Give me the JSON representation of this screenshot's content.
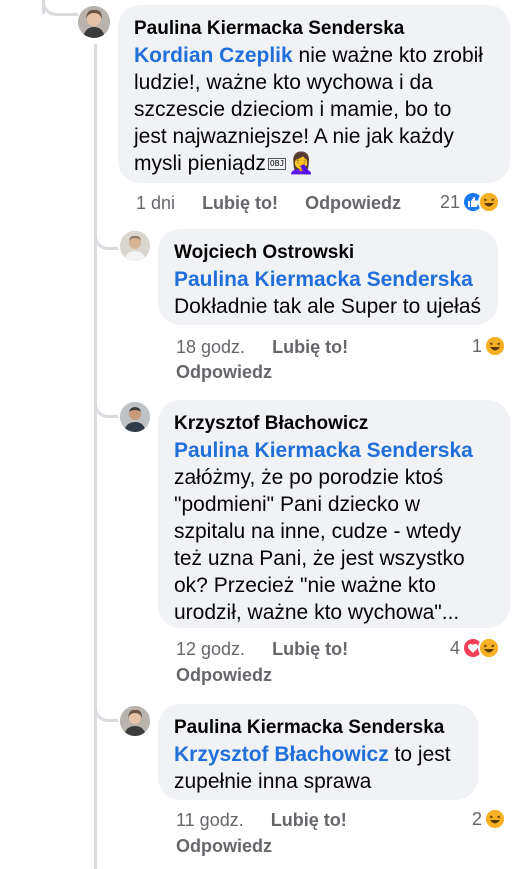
{
  "comments": [
    {
      "author": "Paulina Kiermacka Senderska",
      "mention": "Kordian Czeplik",
      "text_lines": [
        " nie ważne kto zrobił",
        "ludzie!, ważne kto wychowa i da",
        "szczescie dzieciom i mamie, bo to",
        "jest najwazniejsze! A nie jak każdy",
        "mysli pieniądz"
      ],
      "obj_glyph": "OBJ",
      "emoji": "🤦‍♀️",
      "time": "1 dni",
      "like_label": "Lubię to!",
      "reply_label": "Odpowiedz",
      "reaction_count": "21",
      "reactions": [
        "like",
        "haha"
      ]
    },
    {
      "author": "Wojciech Ostrowski",
      "mention": "Paulina Kiermacka Senderska",
      "text": "Dokładnie tak ale Super to ujełaś",
      "time": "18 godz.",
      "like_label": "Lubię to!",
      "reply_label": "Odpowiedz",
      "reaction_count": "1",
      "reactions": [
        "haha"
      ]
    },
    {
      "author": "Krzysztof Błachowicz",
      "mention": "Paulina Kiermacka Senderska",
      "text_lines": [
        "załóżmy, że po porodzie ktoś",
        "\"podmieni\" Pani dziecko w",
        "szpitalu na inne, cudze - wtedy",
        "też uzna Pani, że jest wszystko",
        "ok? Przecież \"nie ważne kto",
        "urodził, ważne kto wychowa\"..."
      ],
      "time": "12 godz.",
      "like_label": "Lubię to!",
      "reply_label": "Odpowiedz",
      "reaction_count": "4",
      "reactions": [
        "love",
        "haha"
      ]
    },
    {
      "author": "Paulina Kiermacka Senderska",
      "mention": "Krzysztof Błachowicz",
      "text_lines": [
        " to jest",
        "zupełnie inna sprawa"
      ],
      "time": "11 godz.",
      "like_label": "Lubię to!",
      "reply_label": "Odpowiedz",
      "reaction_count": "2",
      "reactions": [
        "haha"
      ]
    }
  ],
  "colors": {
    "mention": "#216fdb",
    "bubble": "#f0f2f5",
    "meta": "#65676b",
    "thread_line": "#d9dbdf"
  }
}
